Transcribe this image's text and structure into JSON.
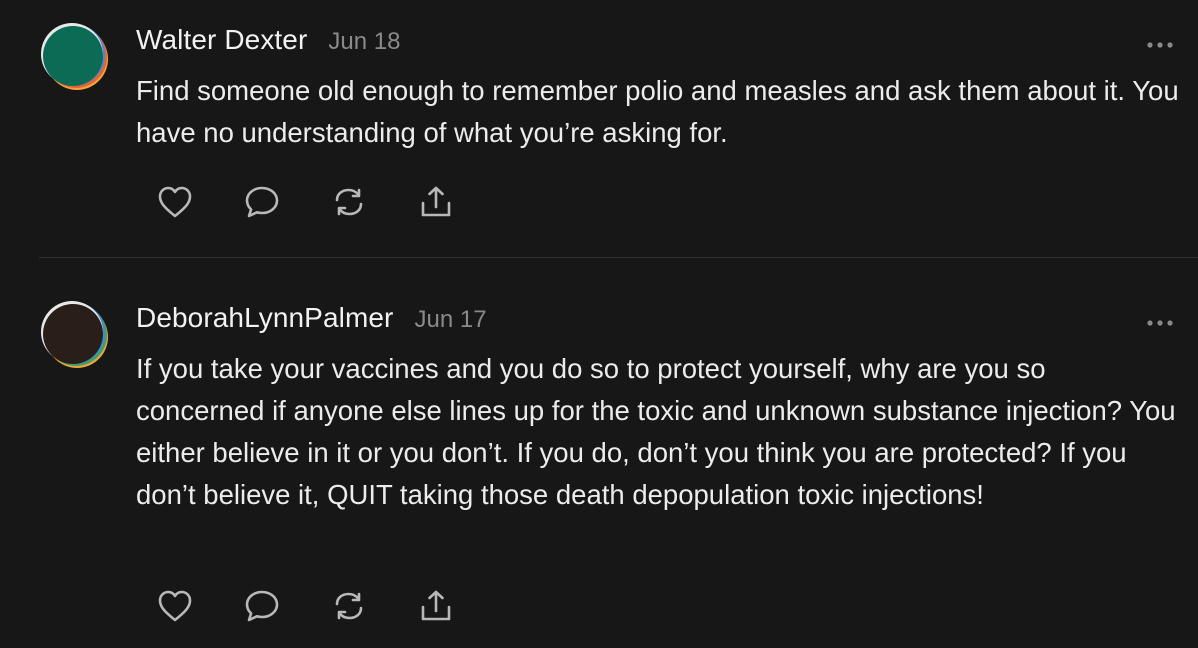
{
  "comments": [
    {
      "author": "Walter Dexter",
      "date": "Jun 18",
      "text": "Find someone old enough to remember polio and measles and ask them about it. You have no understanding of what you’re asking for.",
      "avatar_colors": [
        "#0c6b55",
        "#f2a33a",
        "#3e8be0",
        "#e9622f"
      ]
    },
    {
      "author": "DeborahLynnPalmer",
      "date": "Jun 17",
      "text": "If you take your vaccines and you do so to protect yourself, why are you so concerned if anyone else lines up for the toxic and unknown substance injection? You either believe in it or you don’t. If you do, don’t you think you are protected? If you don’t believe it, QUIT taking those death depopulation toxic injections!",
      "avatar_colors": [
        "#2a1e19",
        "#f2a33a",
        "#3e8be0",
        "#3ba06a"
      ]
    }
  ],
  "icons": {
    "more": "more-horizontal-icon",
    "like": "heart-icon",
    "reply": "speech-bubble-icon",
    "restack": "restack-icon",
    "share": "share-icon"
  },
  "colors": {
    "background": "#171717",
    "text": "#ececec",
    "muted": "#8a8a8a",
    "divider": "#333333"
  }
}
